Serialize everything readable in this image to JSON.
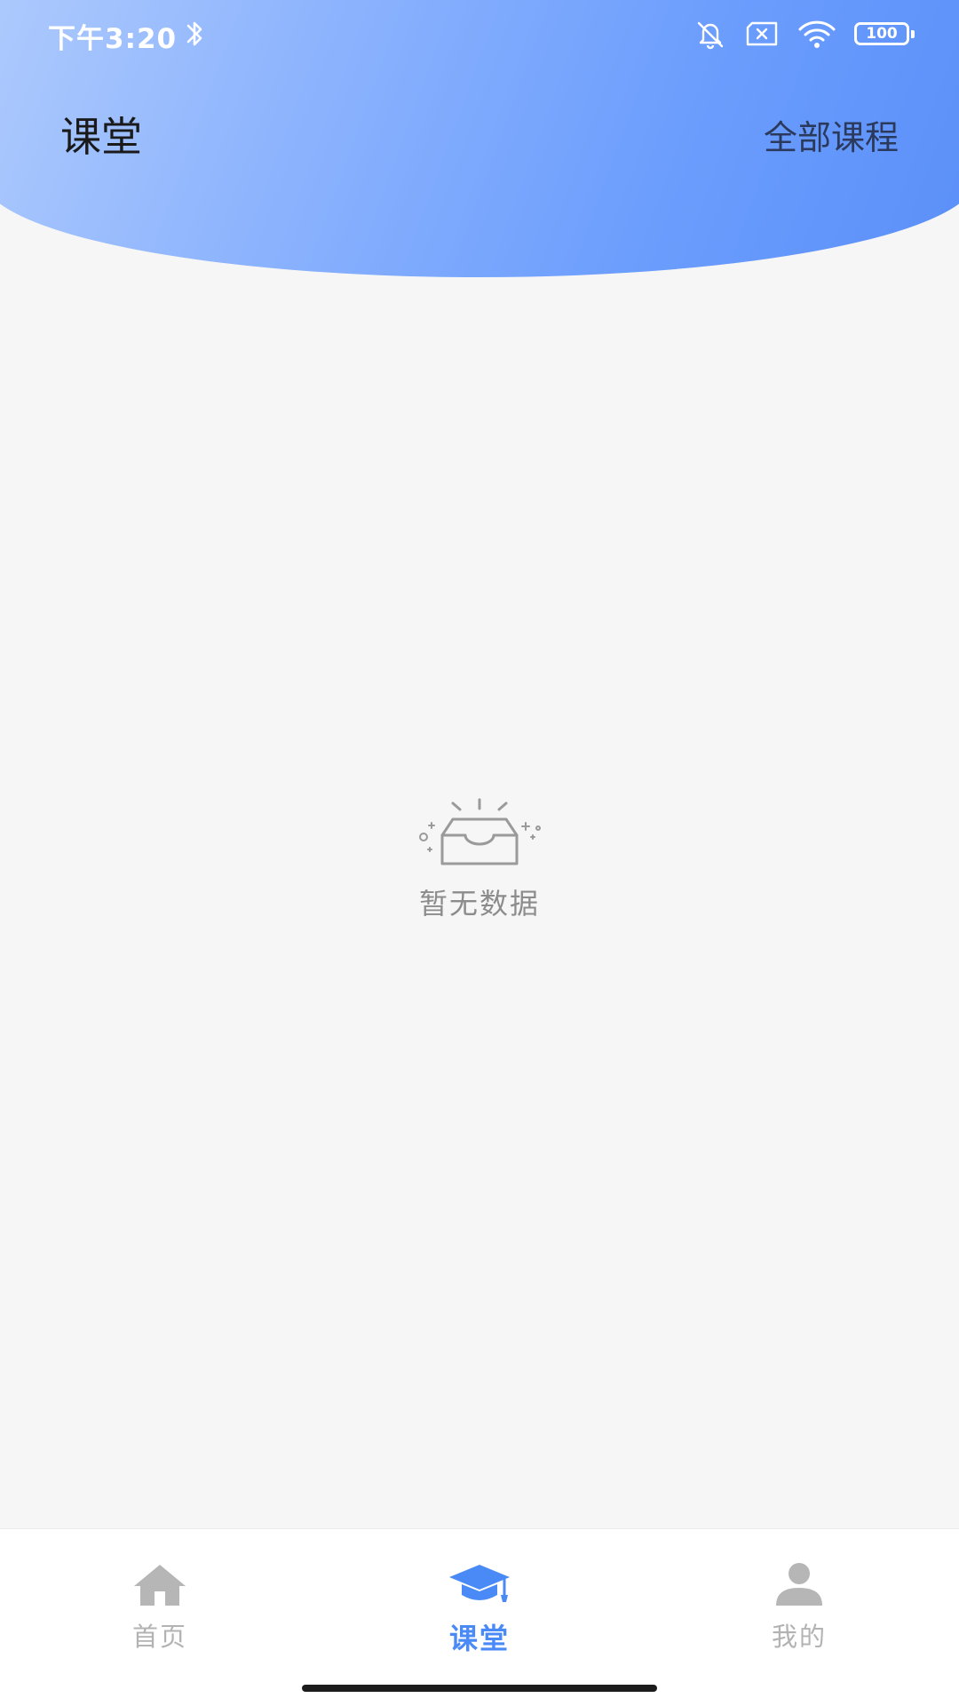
{
  "status_bar": {
    "time": "下午3:20",
    "battery": "100",
    "icons": [
      "bluetooth-icon",
      "bell-muted-icon",
      "sim-x-icon",
      "wifi-icon",
      "battery-icon"
    ]
  },
  "header": {
    "title": "课堂",
    "all_courses_label": "全部课程",
    "gradient_colors": [
      "#b2cdfd",
      "#5a8ff8"
    ]
  },
  "empty_state": {
    "icon": "empty-box-icon",
    "text": "暂无数据"
  },
  "tabbar": {
    "tabs": [
      {
        "label": "首页",
        "icon": "home-icon",
        "active": false
      },
      {
        "label": "课堂",
        "icon": "graduation-cap-icon",
        "active": true
      },
      {
        "label": "我的",
        "icon": "user-icon",
        "active": false
      }
    ],
    "active_color": "#4a8af7",
    "inactive_color": "#b3b3b3"
  }
}
